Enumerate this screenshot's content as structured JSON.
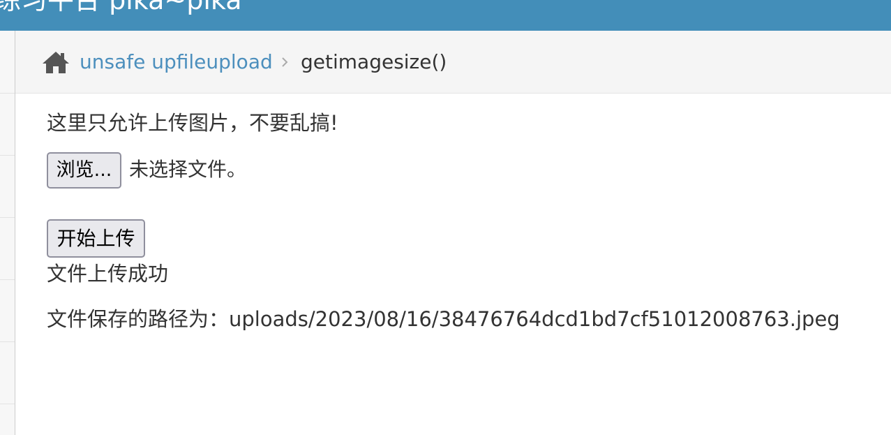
{
  "header": {
    "brand": "练习平台 pika~pika"
  },
  "breadcrumb": {
    "parent": "unsafe upfileupload",
    "current": "getimagesize()"
  },
  "main": {
    "notice": "这里只允许上传图片，不要乱搞!",
    "browse_button": "浏览...",
    "file_status": "未选择文件。",
    "upload_button": "开始上传",
    "success_message": "文件上传成功",
    "path_message": "文件保存的路径为：uploads/2023/08/16/38476764dcd1bd7cf51012008763.jpeg"
  },
  "icons": {
    "home": "home-icon",
    "separator": "chevron-right-icon"
  },
  "colors": {
    "header_bg": "#438eb9",
    "link": "#4c8fbd",
    "breadcrumb_bg": "#f5f5f5"
  }
}
